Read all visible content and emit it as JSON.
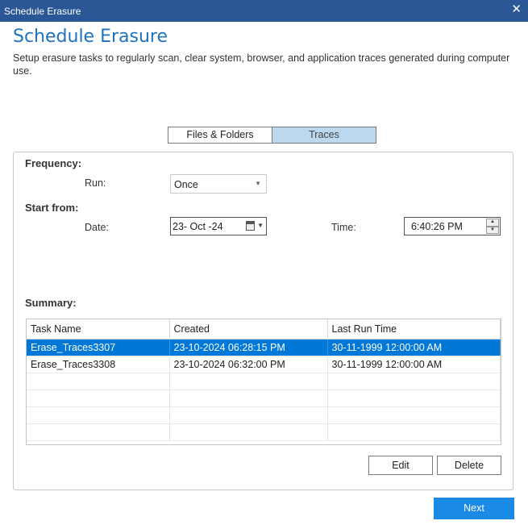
{
  "window": {
    "title": "Schedule Erasure",
    "close_glyph": "✕"
  },
  "header": {
    "title": "Schedule Erasure",
    "description": "Setup erasure tasks to regularly scan, clear system, browser, and application traces generated during computer use."
  },
  "tabs": [
    {
      "label": "Files & Folders",
      "active": false
    },
    {
      "label": "Traces",
      "active": true
    }
  ],
  "frequency": {
    "section_label": "Frequency:",
    "run_label": "Run:",
    "run_value": "Once"
  },
  "start_from": {
    "section_label": "Start from:",
    "date_label": "Date:",
    "date_value": "23- Oct -24",
    "time_label": "Time:",
    "time_value": "6:40:26 PM"
  },
  "summary": {
    "section_label": "Summary:",
    "columns": [
      "Task Name",
      "Created",
      "Last Run Time"
    ],
    "rows": [
      {
        "task": "Erase_Traces3307",
        "created": "23-10-2024 06:28:15 PM",
        "last_run": "30-11-1999 12:00:00 AM",
        "selected": true
      },
      {
        "task": "Erase_Traces3308",
        "created": "23-10-2024 06:32:00 PM",
        "last_run": "30-11-1999 12:00:00 AM",
        "selected": false
      }
    ]
  },
  "buttons": {
    "edit": "Edit",
    "delete": "Delete",
    "next": "Next"
  },
  "colors": {
    "titlebar": "#2b5797",
    "accent": "#1e73be",
    "selection": "#0078d7",
    "next_button": "#1a8ae6",
    "active_tab": "#bcd8ee"
  }
}
